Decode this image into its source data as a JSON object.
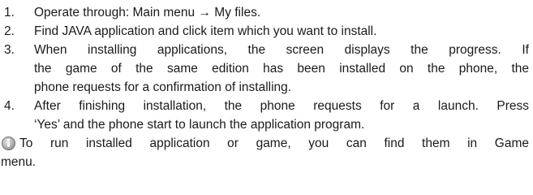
{
  "steps": [
    {
      "number": "1.",
      "lines": [
        "Operate through: Main menu → My files."
      ]
    },
    {
      "number": "2.",
      "lines": [
        "Find JAVA application and click item which you want to install."
      ]
    },
    {
      "number": "3.",
      "lines": [
        "When installing applications, the screen displays the progress. If",
        "the game of the same edition has been installed on the phone, the",
        "phone requests for a confirmation of installing."
      ]
    },
    {
      "number": "4.",
      "lines": [
        "After finishing installation, the phone requests for a launch. Press",
        "‘Yes’ and the phone start to launch the application program."
      ]
    }
  ],
  "note": {
    "icon": "info-note-icon",
    "lines": [
      "To run installed application or game, you can find them in Game",
      "menu."
    ]
  }
}
